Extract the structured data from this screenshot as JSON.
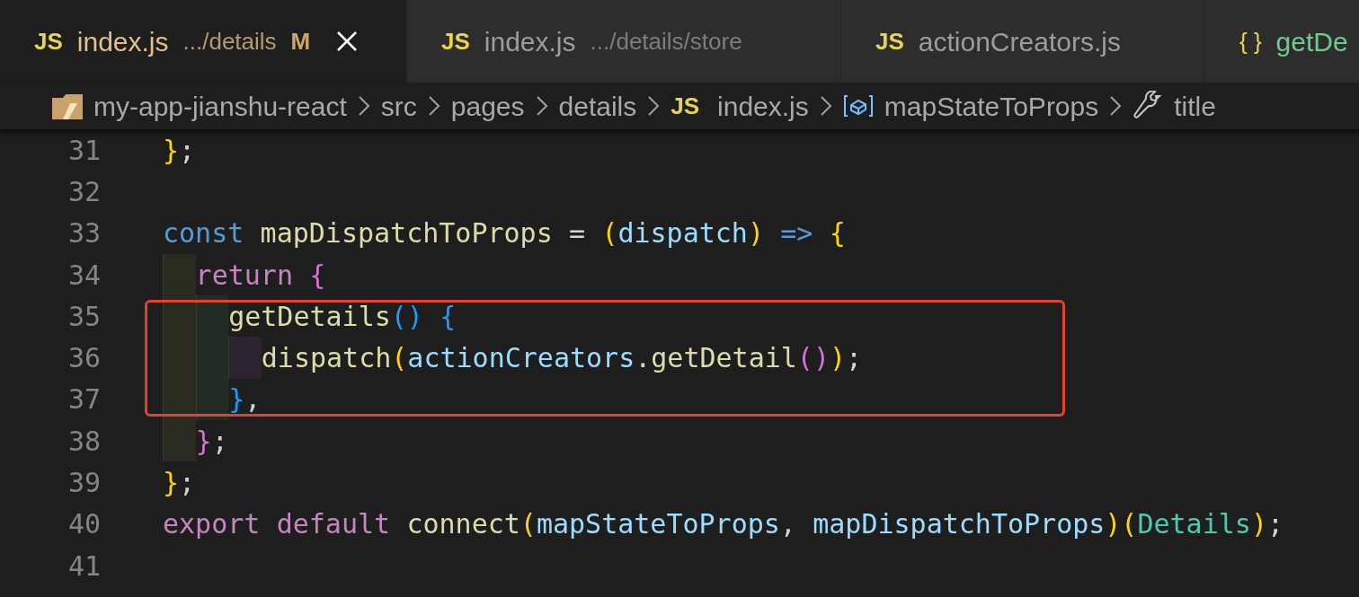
{
  "tabs": [
    {
      "icon": "JS",
      "label": "index.js",
      "description": ".../details",
      "badge": "M",
      "selected": true,
      "kind": "js"
    },
    {
      "icon": "JS",
      "label": "index.js",
      "description": ".../details/store",
      "selected": false,
      "kind": "js"
    },
    {
      "icon": "JS",
      "label": "actionCreators.js",
      "selected": false,
      "kind": "js"
    },
    {
      "icon": "{ }",
      "label": "getDe",
      "selected": false,
      "kind": "json"
    }
  ],
  "breadcrumbs": [
    {
      "kind": "folder",
      "label": "my-app-jianshu-react"
    },
    {
      "kind": "folder",
      "label": "src"
    },
    {
      "kind": "folder",
      "label": "pages"
    },
    {
      "kind": "folder",
      "label": "details"
    },
    {
      "kind": "file",
      "icon": "JS",
      "label": "index.js"
    },
    {
      "kind": "variable",
      "label": "mapStateToProps"
    },
    {
      "kind": "property",
      "label": "title"
    }
  ],
  "code": [
    {
      "number": "31",
      "tokens": [
        {
          "kind": "brace1",
          "text": "}"
        },
        {
          "kind": "punct",
          "text": ";"
        }
      ]
    },
    {
      "number": "32"
    },
    {
      "number": "33",
      "tokens": [
        {
          "kind": "keyword",
          "text": "const"
        },
        {
          "kind": "function",
          "text": "mapDispatchToProps",
          "space_before": true
        },
        {
          "kind": "punct",
          "text": "=",
          "space_before": true
        },
        {
          "kind": "brace1",
          "text": "(",
          "space_before": true
        },
        {
          "kind": "variable",
          "text": "dispatch"
        },
        {
          "kind": "brace1",
          "text": ")"
        },
        {
          "kind": "keyword",
          "text": "=>",
          "space_before": true
        },
        {
          "kind": "brace1",
          "text": "{",
          "space_before": true
        }
      ],
      "children": [
        {
          "number": "34",
          "tokens": [
            {
              "kind": "control",
              "text": "return"
            },
            {
              "kind": "brace2",
              "text": "{",
              "space_before": true
            }
          ],
          "children": [
            {
              "number": "35",
              "tokens": [
                {
                  "kind": "function",
                  "text": "getDetails"
                },
                {
                  "kind": "brace3",
                  "text": "()"
                },
                {
                  "kind": "brace3",
                  "text": "{",
                  "space_before": true
                }
              ],
              "children": [
                {
                  "number": "36",
                  "tokens": [
                    {
                      "kind": "function",
                      "text": "dispatch"
                    },
                    {
                      "kind": "brace1",
                      "text": "("
                    },
                    {
                      "kind": "variable",
                      "text": "actionCreators"
                    },
                    {
                      "kind": "punct",
                      "text": "."
                    },
                    {
                      "kind": "function",
                      "text": "getDetail"
                    },
                    {
                      "kind": "brace2",
                      "text": "()"
                    },
                    {
                      "kind": "brace1",
                      "text": ")"
                    },
                    {
                      "kind": "punct",
                      "text": ";"
                    }
                  ]
                }
              ]
            },
            {
              "number": "37",
              "tokens": [
                {
                  "kind": "brace3",
                  "text": "}"
                },
                {
                  "kind": "punct",
                  "text": ","
                }
              ]
            }
          ]
        },
        {
          "number": "38",
          "tokens": [
            {
              "kind": "brace2",
              "text": "}"
            },
            {
              "kind": "punct",
              "text": ";"
            }
          ]
        }
      ]
    },
    {
      "number": "39",
      "tokens": [
        {
          "kind": "brace1",
          "text": "}"
        },
        {
          "kind": "punct",
          "text": ";"
        }
      ]
    },
    {
      "number": "40",
      "tokens": [
        {
          "kind": "control",
          "text": "export"
        },
        {
          "kind": "control",
          "text": "default",
          "space_before": true
        },
        {
          "kind": "function",
          "text": "connect",
          "space_before": true
        },
        {
          "kind": "brace1",
          "text": "("
        },
        {
          "kind": "variable",
          "text": "mapStateToProps"
        },
        {
          "kind": "punct",
          "text": ","
        },
        {
          "kind": "variable",
          "text": "mapDispatchToProps",
          "space_before": true
        },
        {
          "kind": "brace1",
          "text": ")("
        },
        {
          "kind": "class",
          "text": "Details"
        },
        {
          "kind": "brace1",
          "text": ")"
        },
        {
          "kind": "punct",
          "text": ";"
        }
      ]
    },
    {
      "number": "41"
    }
  ]
}
